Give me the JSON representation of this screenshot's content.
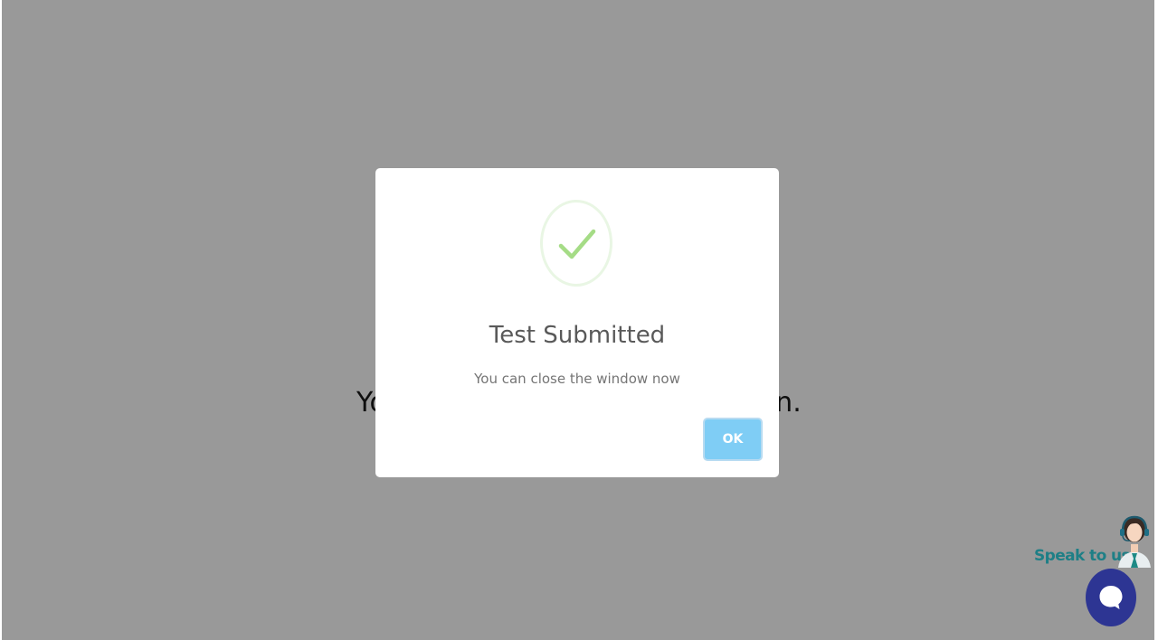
{
  "background": {
    "message_visible_start": "Yo",
    "message_visible_end": "n."
  },
  "modal": {
    "icon": "checkmark-icon",
    "title": "Test Submitted",
    "text": "You can close the window now",
    "ok_label": "OK"
  },
  "support": {
    "label": "Speak to us!",
    "agent_icon": "support-agent-icon",
    "chat_icon": "chat-bubble-icon"
  },
  "colors": {
    "overlay": "#999999",
    "check": "#a5dc86",
    "ok_button": "#7fcdf5",
    "chat_button": "#2d3593",
    "support_label": "#1e7f86"
  }
}
